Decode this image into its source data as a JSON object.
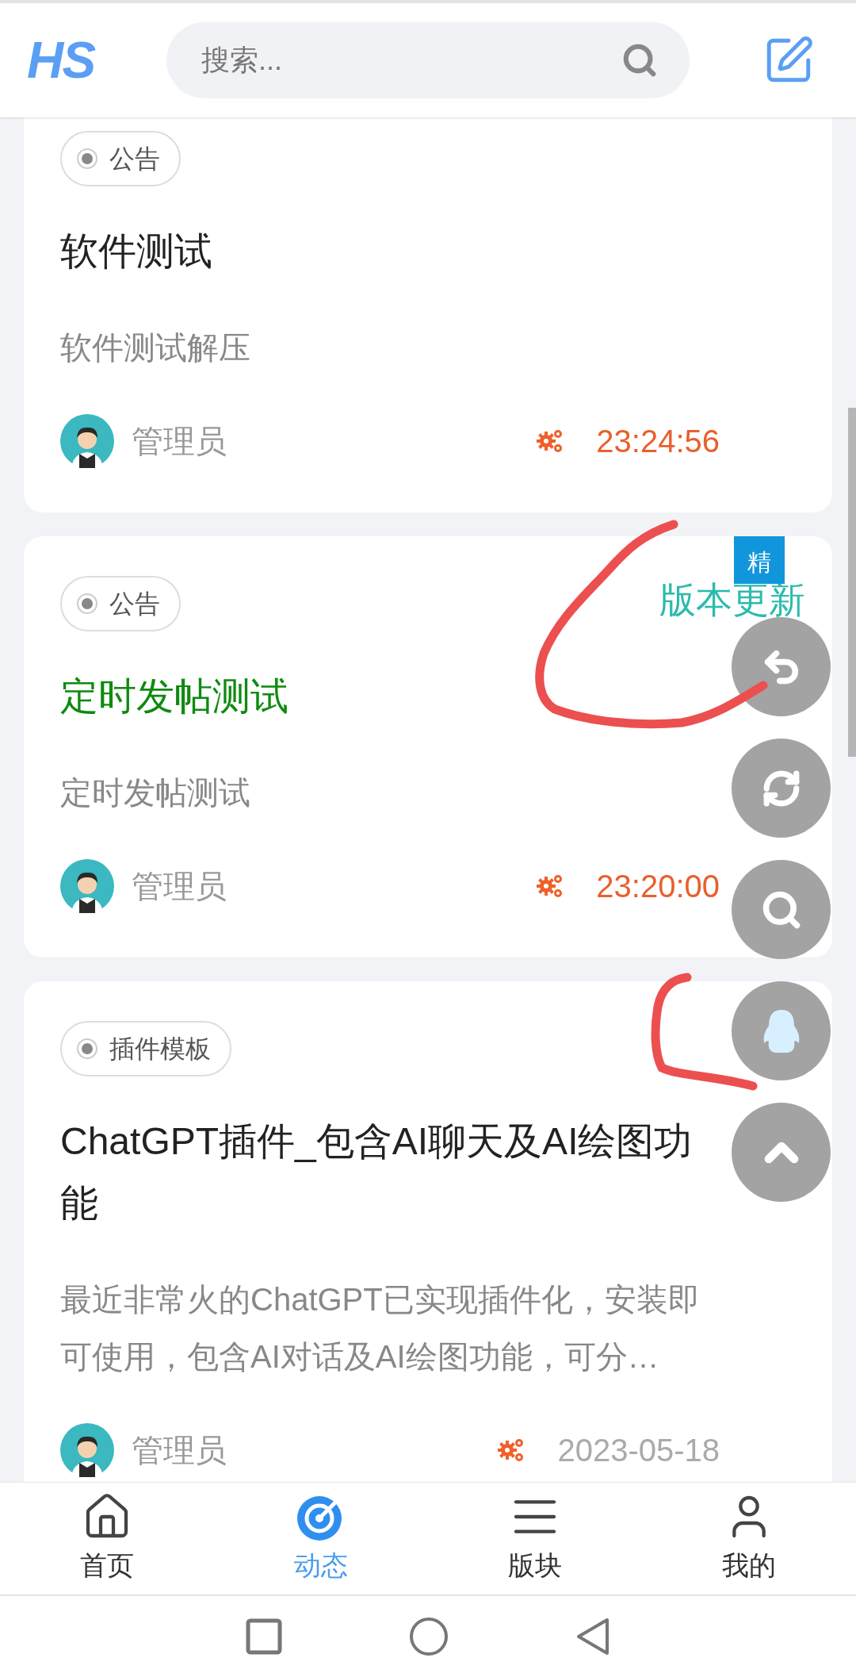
{
  "header": {
    "logo": "HS",
    "search": {
      "placeholder": "搜索..."
    }
  },
  "posts": [
    {
      "tag": "公告",
      "title": "软件测试",
      "color": "#222222",
      "summary": "软件测试解压",
      "author": "管理员",
      "time": "23:24:56",
      "time_highlighted": true
    },
    {
      "tag": "公告",
      "title": "定时发帖测试",
      "color": "#0f8a0f",
      "summary": "定时发帖测试",
      "author": "管理员",
      "time": "23:20:00",
      "time_highlighted": true,
      "category": "版本更新",
      "badge": "精"
    },
    {
      "tag": "插件模板",
      "title": "ChatGPT插件_包含AI聊天及AI绘图功能",
      "color": "#222222",
      "summary": "最近非常火的ChatGPT已实现插件化，安装即可使用，包含AI对话及AI绘图功能，可分…",
      "author": "管理员",
      "time": "2023-05-18",
      "time_highlighted": false
    }
  ],
  "float_buttons": [
    {
      "kind": "reply"
    },
    {
      "kind": "refresh"
    },
    {
      "kind": "search"
    },
    {
      "kind": "penguin"
    },
    {
      "kind": "top"
    }
  ],
  "tabs": [
    {
      "label": "首页",
      "kind": "home",
      "selected": false
    },
    {
      "label": "动态",
      "kind": "feed",
      "selected": true
    },
    {
      "label": "版块",
      "kind": "list",
      "selected": false
    },
    {
      "label": "我的",
      "kind": "user",
      "selected": false
    }
  ]
}
